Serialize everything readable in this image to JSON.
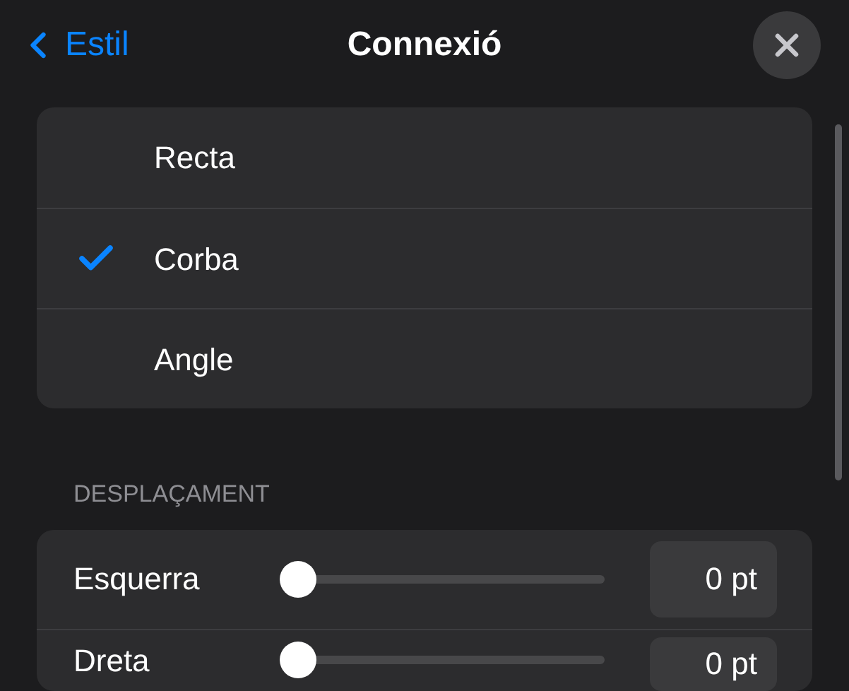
{
  "nav": {
    "back": "Estil",
    "title": "Connexió"
  },
  "options": [
    {
      "label": "Recta",
      "selected": false
    },
    {
      "label": "Corba",
      "selected": true
    },
    {
      "label": "Angle",
      "selected": false
    }
  ],
  "offset": {
    "header": "DESPLAÇAMENT",
    "rows": [
      {
        "label": "Esquerra",
        "level": 0,
        "value": "0 pt"
      },
      {
        "label": "Dreta",
        "level": 0,
        "value": "0 pt"
      }
    ]
  }
}
